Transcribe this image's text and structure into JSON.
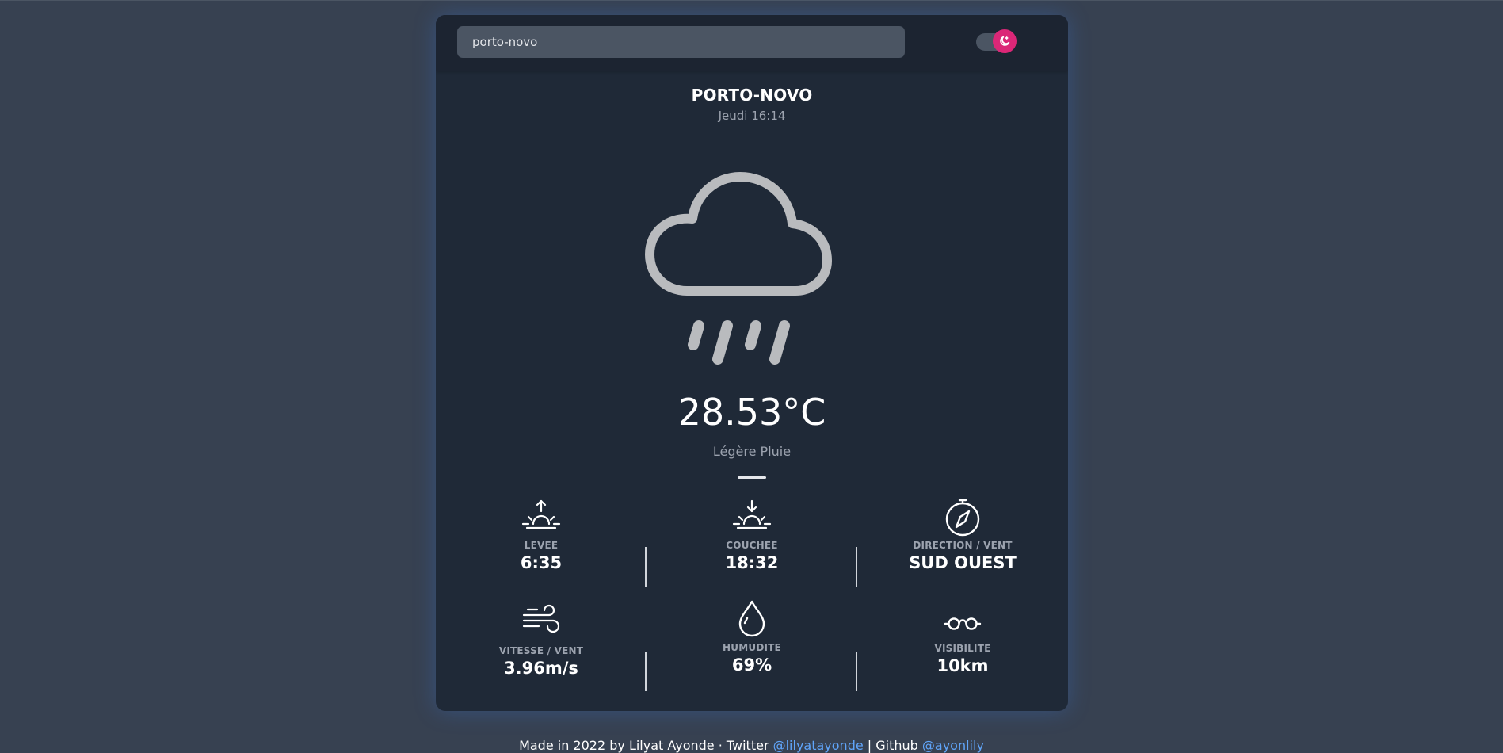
{
  "search": {
    "value": "porto-novo",
    "placeholder": ""
  },
  "theme_toggle": {
    "accent": "#db2777",
    "icon": "moon-icon"
  },
  "location": {
    "city": "PORTO-NOVO",
    "datetime": "Jeudi 16:14"
  },
  "current": {
    "icon": "cloud-rain-icon",
    "temperature": "28.53°C",
    "description": "Légère Pluie"
  },
  "stats": [
    {
      "icon": "sunrise-icon",
      "label": "LEVEE",
      "value": "6:35"
    },
    {
      "icon": "sunset-icon",
      "label": "COUCHEE",
      "value": "18:32"
    },
    {
      "icon": "compass-icon",
      "label": "DIRECTION / VENT",
      "value": "SUD OUEST"
    },
    {
      "icon": "wind-icon",
      "label": "VITESSE / VENT",
      "value": "3.96m/s"
    },
    {
      "icon": "droplet-icon",
      "label": "HUMUDITE",
      "value": "69%"
    },
    {
      "icon": "glasses-icon",
      "label": "VISIBILITE",
      "value": "10km"
    }
  ],
  "footer": {
    "text": "Made in 2022 by Lilyat Ayonde · Twitter ",
    "twitter": "@lilyatayonde",
    "github_prefix": " | Github ",
    "github": "@ayonlily"
  },
  "colors": {
    "page_bg": "#374151",
    "card_bg": "#1f2937",
    "accent": "#db2777",
    "link": "#60a5fa"
  }
}
